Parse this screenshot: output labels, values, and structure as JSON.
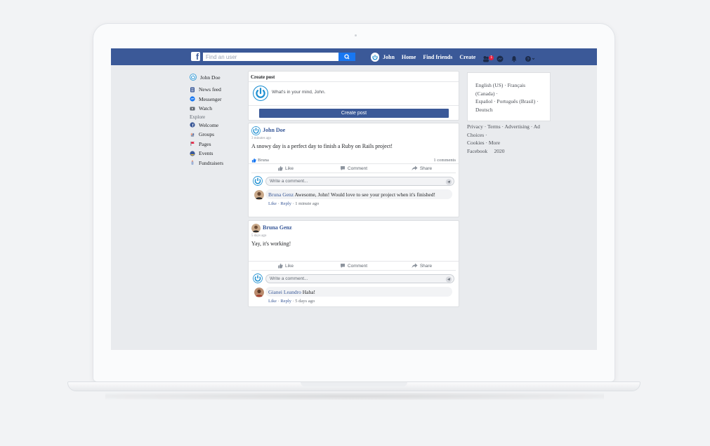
{
  "topbar": {
    "search_placeholder": "Find an user",
    "user_name": "John",
    "nav": [
      "Home",
      "Find friends",
      "Create"
    ],
    "friend_requests_badge": "1",
    "brand_color": "#3b5998"
  },
  "sidebar": {
    "user": "John Doe",
    "items": [
      {
        "label": "News feed",
        "icon": "news-feed-icon"
      },
      {
        "label": "Messenger",
        "icon": "messenger-icon"
      },
      {
        "label": "Watch",
        "icon": "watch-icon"
      }
    ],
    "explore_heading": "Explore",
    "explore": [
      {
        "label": "Welcome",
        "icon": "welcome-icon"
      },
      {
        "label": "Groups",
        "icon": "groups-icon"
      },
      {
        "label": "Pages",
        "icon": "pages-icon"
      },
      {
        "label": "Events",
        "icon": "events-icon"
      },
      {
        "label": "Fundraisers",
        "icon": "fundraisers-icon"
      }
    ]
  },
  "create_post": {
    "title": "Create post",
    "placeholder": "What's in your mind, John.",
    "button": "Create post"
  },
  "posts": [
    {
      "author": "John Doe",
      "time": "3 minutes ago",
      "body": "A snowy day is a perfect day to finish a Ruby on Rails project!",
      "likes": "Bruna",
      "comments_count": "1 comments",
      "actions": [
        "Like",
        "Comment",
        "Share"
      ],
      "comment_placeholder": "Write a comment...",
      "comment": {
        "author": "Bruna Genz",
        "text": "Awesome, John! Would love to see your project when it's finished!",
        "like": "Like",
        "reply": "Reply",
        "time": "1 minute ago"
      }
    },
    {
      "author": "Bruna Genz",
      "time": "5 days ago",
      "body": "Yay, it's working!",
      "actions": [
        "Like",
        "Comment",
        "Share"
      ],
      "comment_placeholder": "Write a comment...",
      "comment": {
        "author": "Gianei Leandro",
        "text": "Haha!",
        "like": "Like",
        "reply": "Reply",
        "time": "5 days ago"
      }
    }
  ],
  "languages": {
    "line1": "English (US) · Français (Canada) ·",
    "line2": "Español · Português (Brasil) · Deutsch"
  },
  "footer": {
    "line1": "Privacy · Terms · Advertising · Ad Choices ·",
    "line2": "Cookies · More",
    "line3": "Facebook     2020"
  }
}
